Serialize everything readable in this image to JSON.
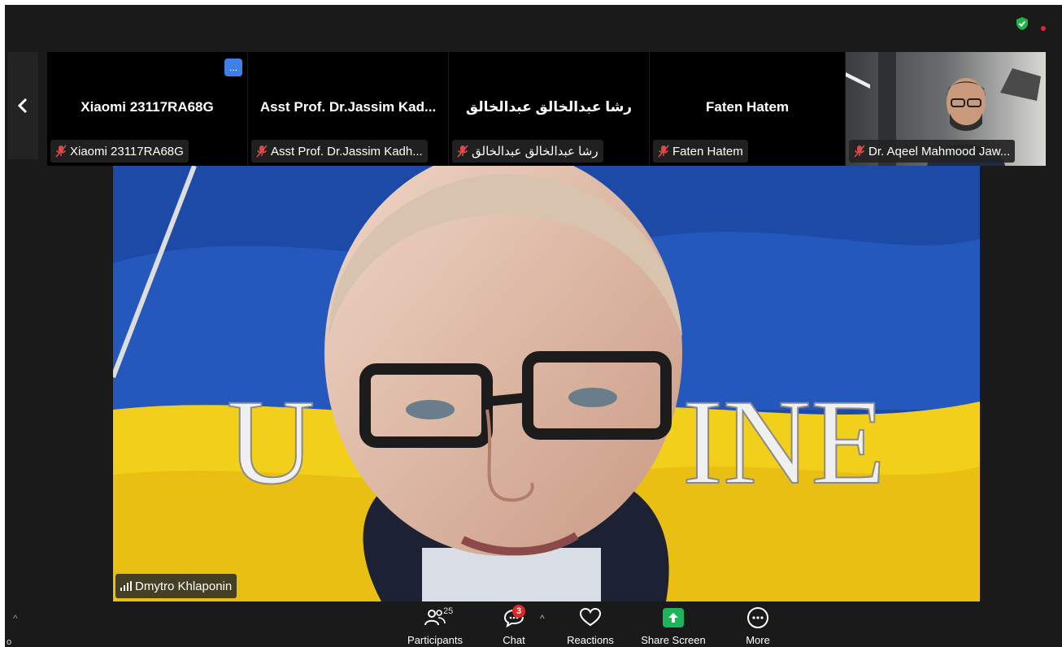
{
  "top_bar": {
    "status": "shield-check-icon",
    "recording_dot_color": "#e02828"
  },
  "thumbnails": [
    {
      "center_name": "Xiaomi 23117RA68G",
      "tag": "Xiaomi 23117RA68G",
      "muted": true,
      "has_more_badge": true,
      "more_badge": "..."
    },
    {
      "center_name": "Asst Prof. Dr.Jassim Kad...",
      "tag": "Asst Prof. Dr.Jassim Kadh...",
      "muted": true
    },
    {
      "center_name": "رشا عبدالخالق عبدالخالق",
      "tag": "رشا عبدالخالق عبدالخالق",
      "muted": true
    },
    {
      "center_name": "Faten Hatem",
      "tag": "Faten Hatem",
      "muted": true
    },
    {
      "center_name": "",
      "tag": "Dr. Aqeel Mahmood Jaw...",
      "muted": true,
      "has_video": true
    }
  ],
  "main_speaker": {
    "name": "Dmytro Khlaponin",
    "background_text": "UKRAINE",
    "background_visible_text_left": "U",
    "background_visible_text_right": "INE",
    "flag_colors": {
      "blue": "#1f57b8",
      "yellow": "#f2d21b"
    }
  },
  "toolbar": {
    "participants": {
      "label": "Participants",
      "count": "25"
    },
    "chat": {
      "label": "Chat",
      "badge": "3"
    },
    "reactions": {
      "label": "Reactions"
    },
    "share": {
      "label": "Share Screen",
      "color": "#1fb35a"
    },
    "more": {
      "label": "More"
    }
  },
  "left_edge": {
    "letter": "o"
  }
}
